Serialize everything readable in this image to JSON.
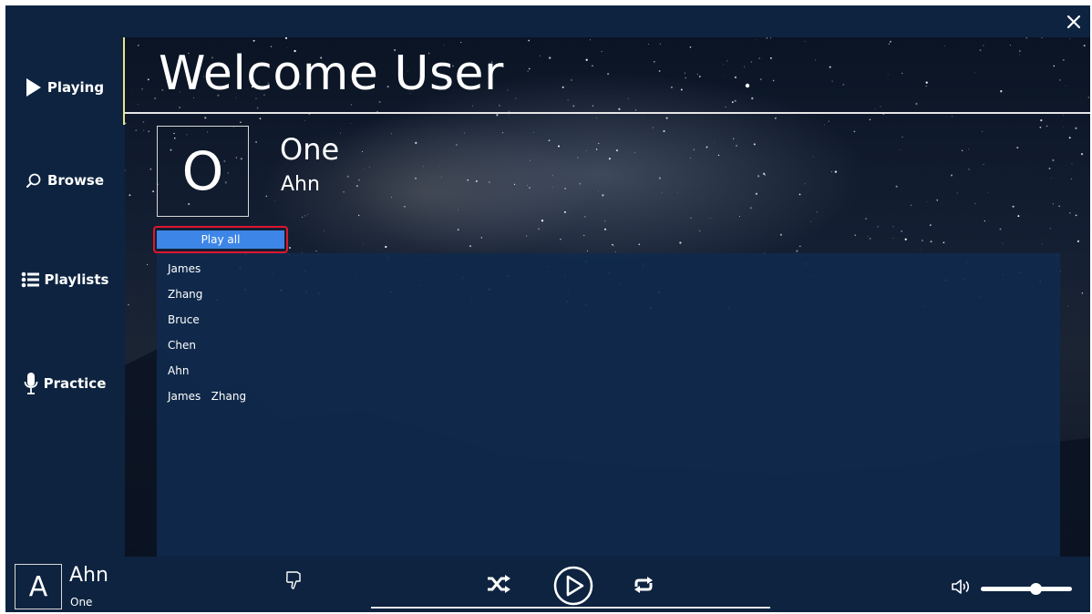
{
  "window": {
    "close_icon": "close-icon"
  },
  "sidebar": {
    "items": [
      {
        "label": "Playing",
        "icon": "play-triangle-icon"
      },
      {
        "label": "Browse",
        "icon": "search-icon"
      },
      {
        "label": "Playlists",
        "icon": "list-icon"
      },
      {
        "label": "Practice",
        "icon": "microphone-icon"
      }
    ]
  },
  "main": {
    "title": "Welcome User",
    "album": {
      "art_letter": "O",
      "title": "One",
      "artist": "Ahn"
    },
    "play_all_label": "Play all",
    "tracks": [
      "James",
      "Zhang",
      "Bruce",
      "Chen",
      "Ahn",
      "James   Zhang"
    ]
  },
  "player": {
    "art_letter": "A",
    "artist": "Ahn",
    "title": "One",
    "volume_level": 0.6,
    "icons": [
      "thumbs-down-icon",
      "shuffle-icon",
      "play-circle-icon",
      "repeat-icon",
      "volume-icon"
    ]
  },
  "colors": {
    "app_bg": "#0d2340",
    "accent_blue": "#3d86e8",
    "highlight_red": "#e0152e",
    "sidebar_accent": "#e8e38a"
  }
}
